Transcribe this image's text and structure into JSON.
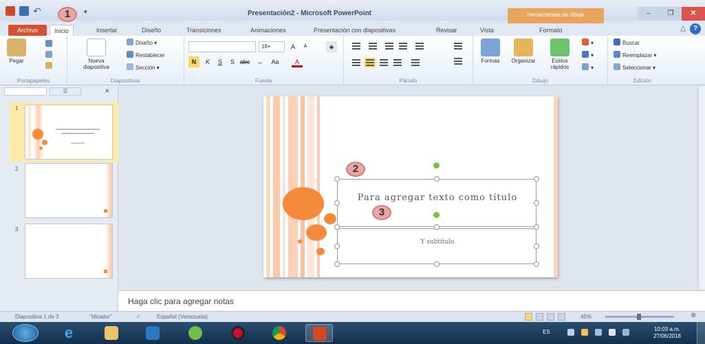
{
  "window": {
    "title": "Presentación2 - Microsoft PowerPoint",
    "contextual_tab": "Herramientas de dibujo"
  },
  "markers": {
    "m1": "1",
    "m2": "2",
    "m3": "3"
  },
  "tabs": [
    {
      "label": "Archivo"
    },
    {
      "label": "Inicio"
    },
    {
      "label": "Insertar"
    },
    {
      "label": "Diseño"
    },
    {
      "label": "Transiciones"
    },
    {
      "label": "Animaciones"
    },
    {
      "label": "Presentación con diapositivas"
    },
    {
      "label": "Revisar"
    },
    {
      "label": "Vista"
    },
    {
      "label": "Formato"
    }
  ],
  "ribbon": {
    "clipboard": {
      "paste": "Pegar",
      "group": "Portapapeles"
    },
    "slides": {
      "new_slide": "Nueva diapositiva",
      "layout": "Diseño",
      "reset": "Restablecer",
      "section": "Sección",
      "group": "Diapositivas"
    },
    "font": {
      "font_name": "",
      "font_size": "18+",
      "group": "Fuente"
    },
    "paragraph": {
      "group": "Párrafo"
    },
    "drawing": {
      "shapes": "Formas",
      "arrange": "Organizar",
      "quick_styles": "Estilos rápidos",
      "group": "Dibujo"
    },
    "editing": {
      "find": "Buscar",
      "replace": "Reemplazar",
      "select": "Seleccionar",
      "group": "Edición"
    }
  },
  "thumbnails": {
    "pane_tab_outline": "☰",
    "items": [
      {
        "number": "1"
      },
      {
        "number": "2"
      },
      {
        "number": "3"
      }
    ]
  },
  "slide": {
    "title_placeholder": "Para agregar texto como título",
    "subtitle_placeholder": "Y subtítulo"
  },
  "notes": {
    "placeholder": "Haga clic para agregar notas"
  },
  "status": {
    "slide_count": "Diapositiva 1 de 3",
    "theme": "\"Mirador\"",
    "language": "Español (Venezuela)",
    "zoom": "45%"
  },
  "taskbar": {
    "language": "ES",
    "time": "10:03 a.m.",
    "date": "27/06/2018"
  },
  "colors": {
    "accent_orange": "#f58a3b",
    "archivo_tab": "#d35230",
    "contextual_tab": "#e9a45c",
    "selection_handle": "#7ac142"
  }
}
